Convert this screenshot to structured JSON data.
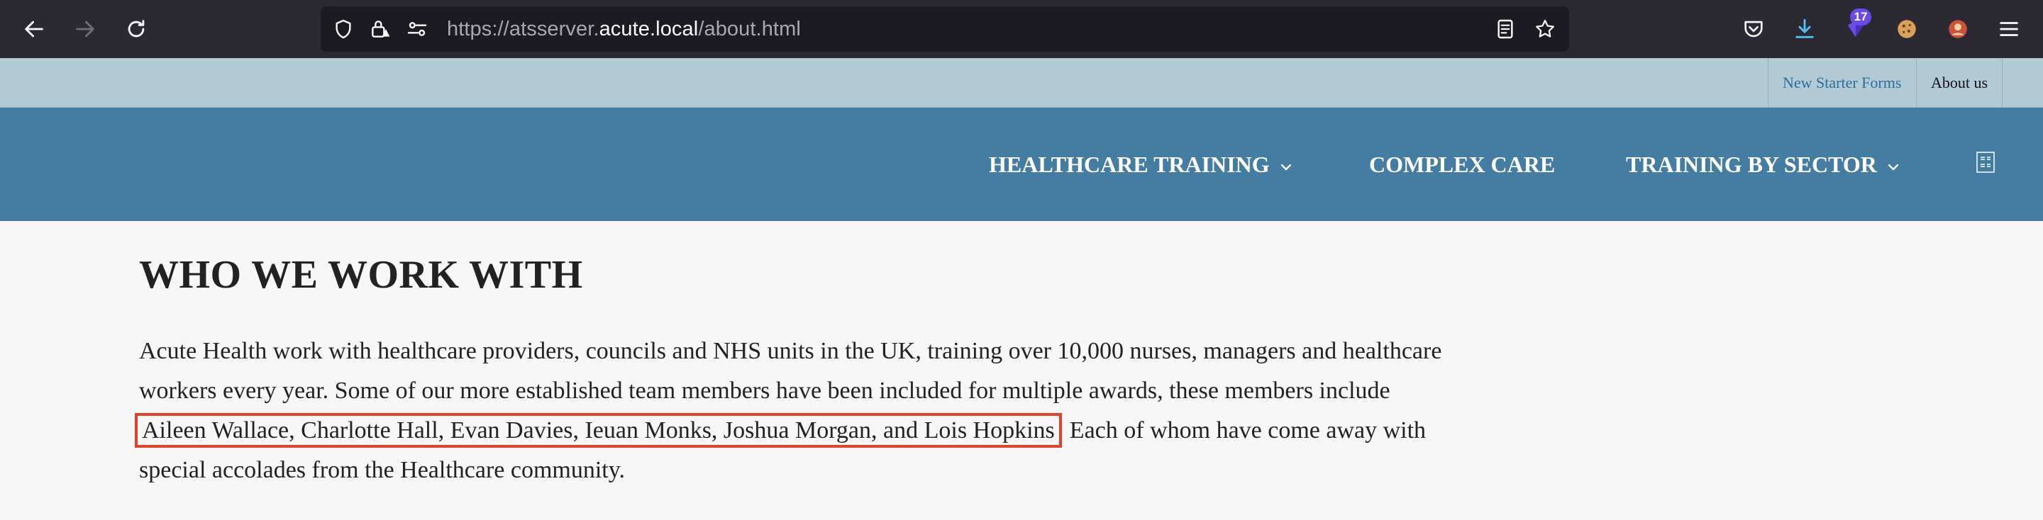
{
  "browser": {
    "url_prefix": "https://atsserver.",
    "url_host": "acute.local",
    "url_path": "/about.html",
    "extension_badge": "17"
  },
  "utility_nav": {
    "new_starter": "New Starter Forms",
    "about": "About us"
  },
  "main_nav": {
    "items": [
      {
        "label": "HEALTHCARE TRAINING",
        "has_dropdown": true
      },
      {
        "label": "COMPLEX CARE",
        "has_dropdown": false
      },
      {
        "label": "TRAINING BY SECTOR",
        "has_dropdown": true
      }
    ]
  },
  "content": {
    "heading": "WHO WE WORK WITH",
    "para_before": "Acute Health work with healthcare providers, councils and NHS units in the UK, training over 10,000 nurses, managers and healthcare workers every year. Some of our more established team members have been included for multiple awards, these members include",
    "para_highlight": "Aileen Wallace, Charlotte Hall, Evan Davies, Ieuan Monks, Joshua Morgan, and Lois Hopkins",
    "para_after": ". Each of whom have come away with special accolades from the Healthcare community."
  },
  "colors": {
    "toolbar": "#2b2a33",
    "utility_bar": "#b1cad6",
    "main_nav": "#457da2",
    "highlight_box": "#e1442c"
  }
}
